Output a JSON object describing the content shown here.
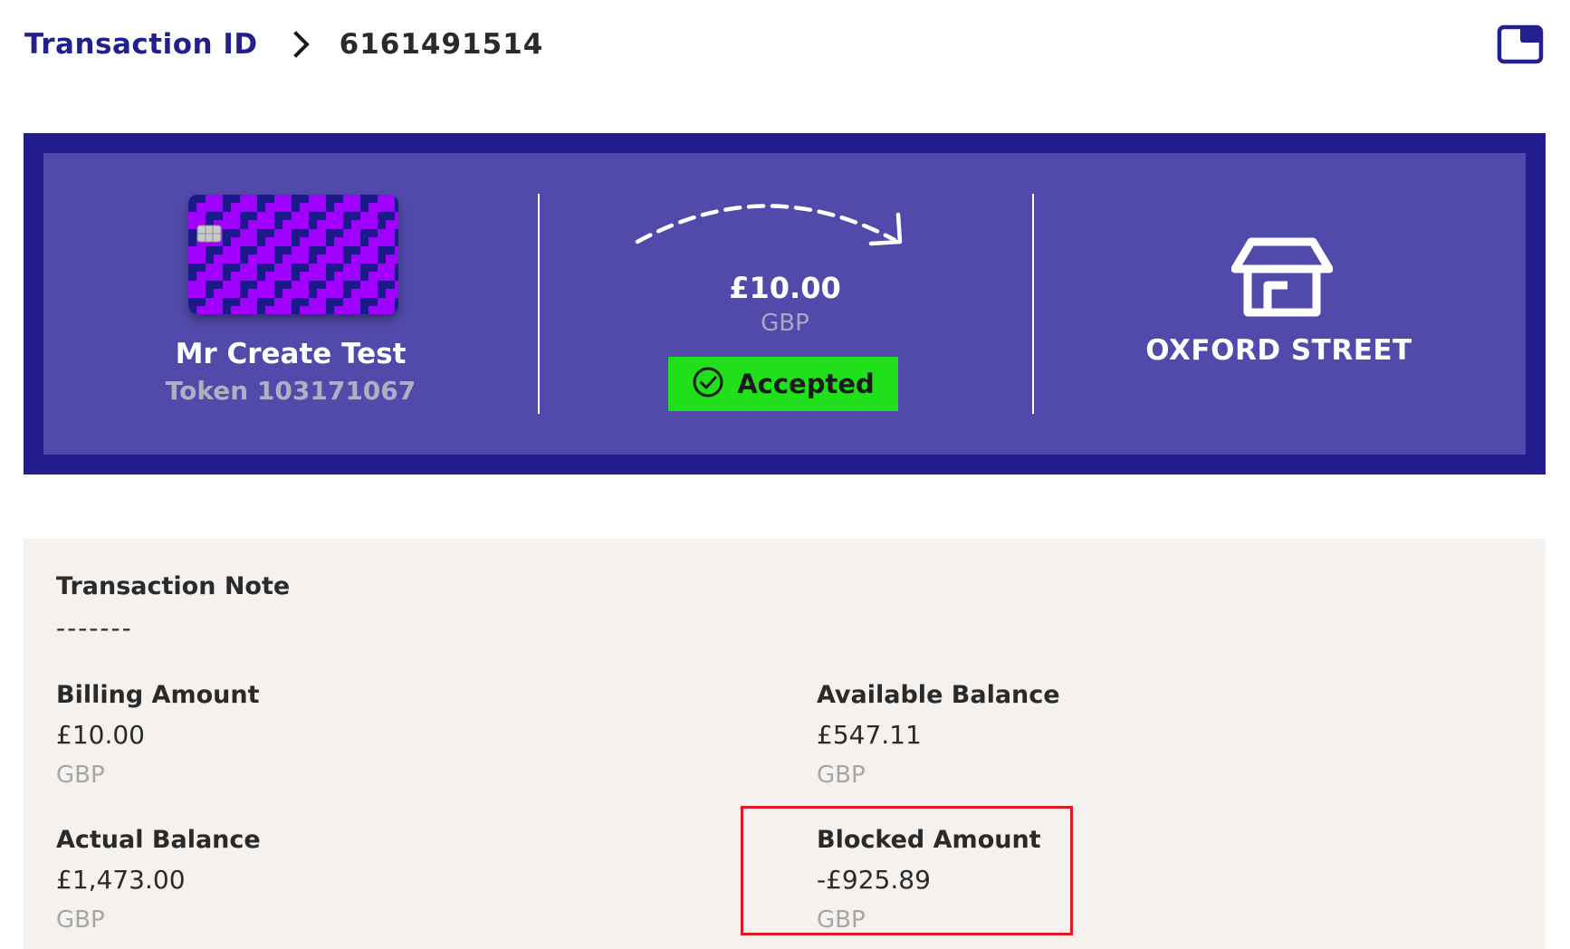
{
  "breadcrumb": {
    "link_label": "Transaction ID",
    "separator_icon": "chevron-right-icon",
    "current": "6161491514"
  },
  "header": {
    "window_icon": "window-icon"
  },
  "card": {
    "holder_name": "Mr Create Test",
    "token": "Token 103171067",
    "card_colors": {
      "primary": "#a000ff",
      "secondary": "#1c1a8a"
    }
  },
  "transaction": {
    "amount": "£10.00",
    "currency": "GBP",
    "status": "Accepted",
    "status_color": "#1fe01a",
    "arrow_icon": "curved-arrow-icon"
  },
  "merchant": {
    "icon": "store-icon",
    "name": "OXFORD STREET"
  },
  "details": {
    "note": {
      "label": "Transaction Note",
      "value": "-------"
    },
    "billing": {
      "label": "Billing Amount",
      "value": "£10.00",
      "currency": "GBP"
    },
    "available": {
      "label": "Available Balance",
      "value": "£547.11",
      "currency": "GBP"
    },
    "actual": {
      "label": "Actual Balance",
      "value": "£1,473.00",
      "currency": "GBP"
    },
    "blocked": {
      "label": "Blocked Amount",
      "value": "-£925.89",
      "currency": "GBP"
    }
  },
  "colors": {
    "brand_dark": "#231d8e",
    "brand_mid": "#524aab",
    "highlight": "#e01a22",
    "details_bg": "#f4f1ee"
  }
}
